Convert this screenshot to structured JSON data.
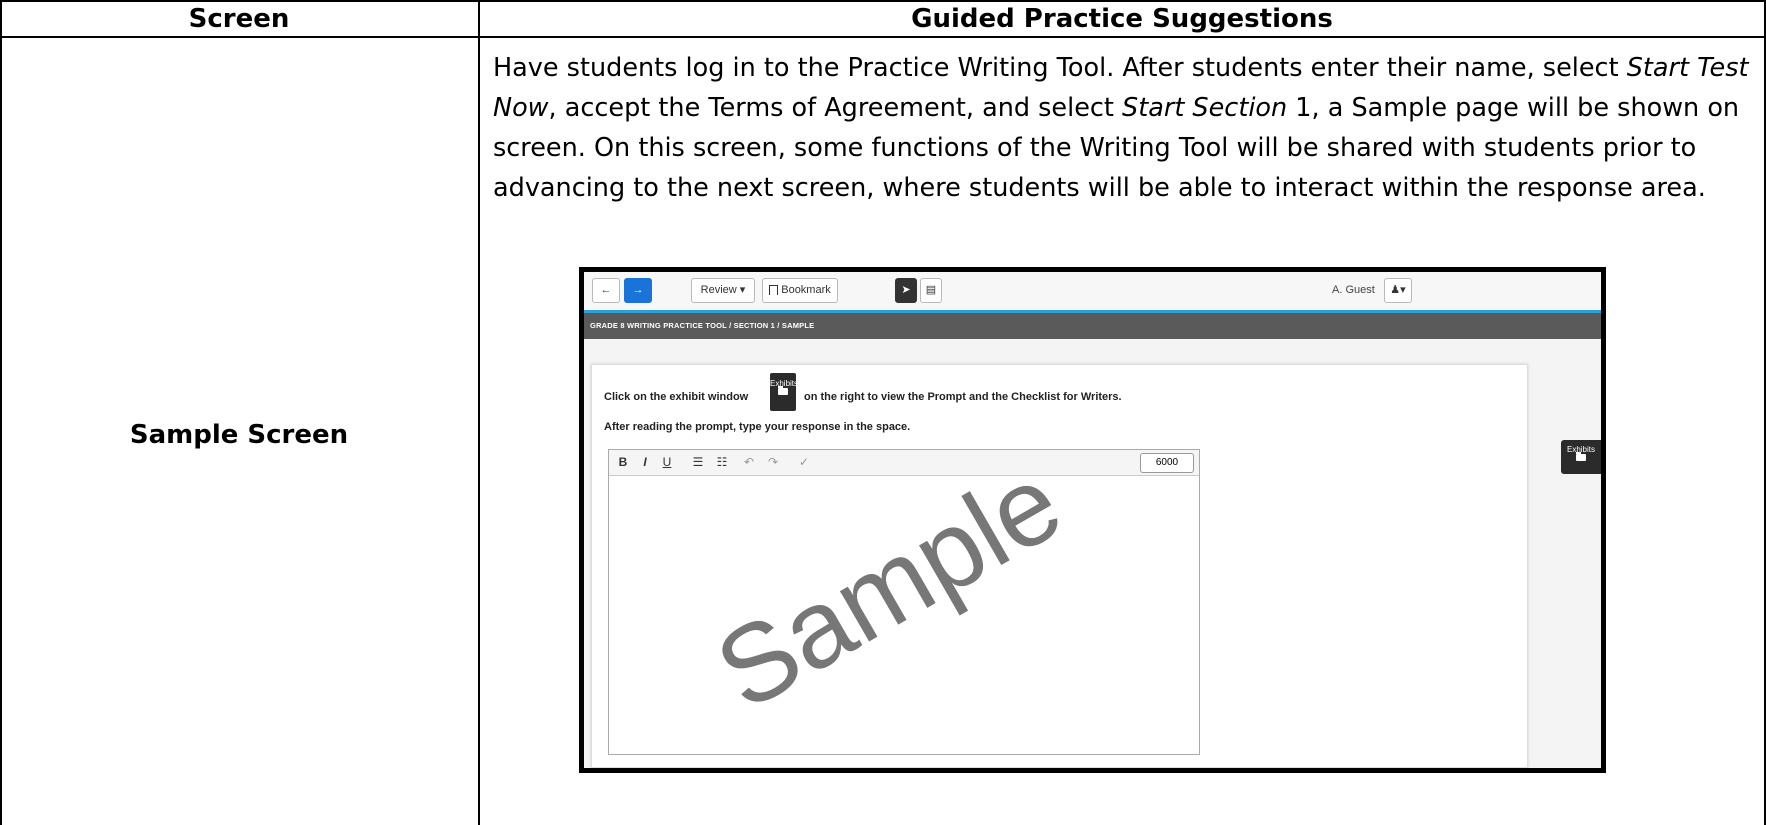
{
  "table": {
    "col1_header": "Screen",
    "col2_header": "Guided Practice Suggestions",
    "row_label": "Sample Screen"
  },
  "paragraph": {
    "p1": "Have students log in to the Practice Writing Tool.  After students enter their name, select ",
    "i1": "Start Test Now",
    "p2": ", accept the Terms of Agreement, and select ",
    "i2": "Start Section",
    "p3": " 1, a Sample page will be shown on screen.  On this screen, some functions of the Writing Tool will be shared with students prior to advancing to the next screen, where students will be able to interact within the response area."
  },
  "screenshot": {
    "toolbar": {
      "back_icon": "←",
      "next_icon": "→",
      "review_label": "Review ▾",
      "bookmark_label": "Bookmark",
      "user_name": "A. Guest",
      "user_menu": "▾"
    },
    "breadcrumb": "GRADE 8 WRITING PRACTICE TOOL   /   SECTION 1   /   SAMPLE",
    "instruction1_a": "Click on the exhibit window",
    "instruction1_b": "on the right to view the Prompt and the Checklist for Writers.",
    "instruction2": "After reading the prompt, type your response in the space.",
    "exhibits_label": "Exhibits",
    "editor": {
      "bold": "B",
      "italic": "I",
      "underline": "U",
      "char_count": "6000"
    },
    "watermark": "Sample",
    "side_exhibits_label": "Exhibits"
  }
}
